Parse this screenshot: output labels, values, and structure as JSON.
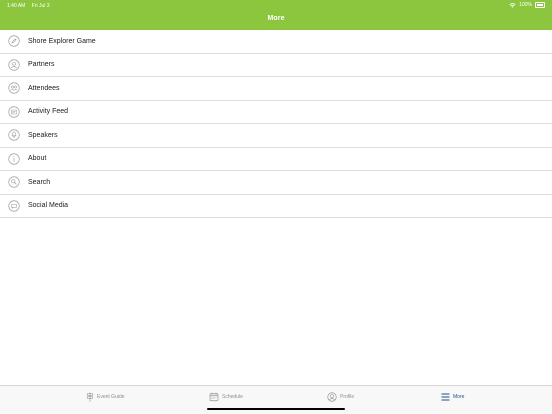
{
  "status": {
    "time": "1:40 AM",
    "date": "Fri Jul 3",
    "battery": "100%"
  },
  "header": {
    "title": "More"
  },
  "menu": [
    {
      "label": "Shore Explorer Game",
      "icon": "compass-icon"
    },
    {
      "label": "Partners",
      "icon": "partners-icon"
    },
    {
      "label": "Attendees",
      "icon": "attendees-icon"
    },
    {
      "label": "Activity Feed",
      "icon": "activity-feed-icon"
    },
    {
      "label": "Speakers",
      "icon": "speakers-icon"
    },
    {
      "label": "About",
      "icon": "about-icon"
    },
    {
      "label": "Search",
      "icon": "search-icon"
    },
    {
      "label": "Social Media",
      "icon": "social-media-icon"
    }
  ],
  "tabs": [
    {
      "label": "Event Guide",
      "icon": "signpost-icon"
    },
    {
      "label": "Schedule",
      "icon": "calendar-icon"
    },
    {
      "label": "Profile",
      "icon": "profile-icon"
    },
    {
      "label": "More",
      "icon": "menu-icon",
      "active": true
    }
  ],
  "colors": {
    "header": "#8cc63e",
    "active_tab": "#1f4e8c",
    "icon_gray": "#9a9a9a"
  }
}
